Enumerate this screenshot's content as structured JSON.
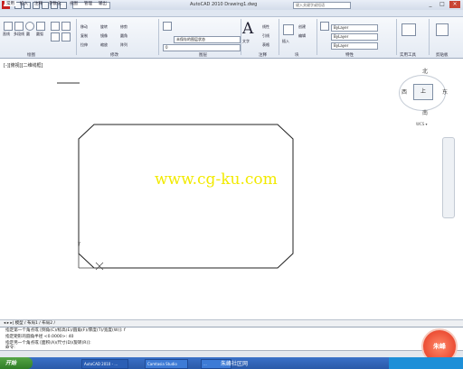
{
  "window": {
    "app_logo": "A",
    "title": "AutoCAD 2010    Drawing1.dwg",
    "search_placeholder": "键入关键字或短语",
    "controls": [
      "_",
      "□",
      "×"
    ]
  },
  "tabs": [
    "常用",
    "插入",
    "注释",
    "参数化",
    "视图",
    "管理",
    "输出"
  ],
  "ribbon": {
    "draw": {
      "title": "绘图",
      "items": [
        "直线",
        "多段线",
        "圆",
        "圆弧"
      ]
    },
    "modify": {
      "title": "修改",
      "items": [
        "移动",
        "旋转",
        "修剪",
        "复制",
        "镜像",
        "圆角",
        "拉伸",
        "缩放",
        "阵列"
      ]
    },
    "layers": {
      "title": "图层",
      "current_layer": "0",
      "layer_state": "未保存的图层状态"
    },
    "annotation": {
      "title": "注释",
      "items": [
        "文字",
        "线性",
        "引线",
        "表格"
      ]
    },
    "block": {
      "title": "块",
      "items": [
        "插入",
        "创建",
        "编辑"
      ]
    },
    "properties": {
      "title": "特性",
      "color": "ByLayer",
      "linetype": "ByLayer",
      "lineweight": "ByLayer"
    },
    "utilities": {
      "title": "实用工具"
    },
    "clipboard": {
      "title": "剪贴板"
    }
  },
  "viewport": {
    "label": "[-][俯视][二维线框]",
    "viewcube": {
      "north": "北",
      "south": "南",
      "west": "西",
      "east": "东",
      "top": "上"
    },
    "wcs": "WCS ▾",
    "watermark": "www.cg-ku.com"
  },
  "layout_tabs": "◂ ▸ ▸| 模型 / 布局1 / 布局2 /",
  "command_lines": [
    "指定第一个角点或 [倒角(C)/标高(E)/圆角(F)/厚度(T)/宽度(W)]: f",
    "指定矩形的圆角半径 <0.0000>: 40",
    "指定另一个角点或 [面积(A)/尺寸(D)/旋转(R)]:"
  ],
  "command_prompt": "命令:",
  "taskbar": {
    "start": "开始",
    "items": [
      "AutoCAD 2010 - ...",
      "Camtasia Studio",
      "..."
    ],
    "site_text": "朱峰社区网"
  },
  "logo_badge": "朱峰"
}
